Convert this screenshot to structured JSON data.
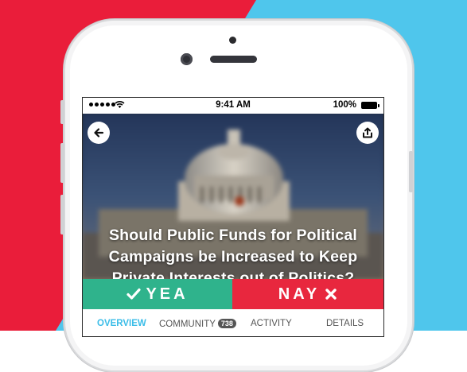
{
  "status_bar": {
    "time": "9:41 AM",
    "battery": "100%"
  },
  "question": {
    "line1": "Should Public Funds for Political",
    "line2": "Campaigns be Increased to Keep",
    "line3": "Private Interests out of Politics?"
  },
  "vote": {
    "yea_label": "YEA",
    "nay_label": "NAY"
  },
  "tabs": [
    {
      "label": "OVERVIEW",
      "active": true
    },
    {
      "label": "COMMUNITY",
      "badge": "738"
    },
    {
      "label": "ACTIVITY"
    },
    {
      "label": "DETAILS"
    }
  ],
  "colors": {
    "yea": "#2fb38c",
    "nay": "#e8273e",
    "active_tab": "#3bbde8",
    "bg_red": "#ea1d3a",
    "bg_blue": "#4fc6ec"
  },
  "icons": [
    "back-arrow-icon",
    "share-icon",
    "check-icon",
    "x-icon",
    "wifi-icon",
    "battery-icon",
    "signal-icon"
  ]
}
